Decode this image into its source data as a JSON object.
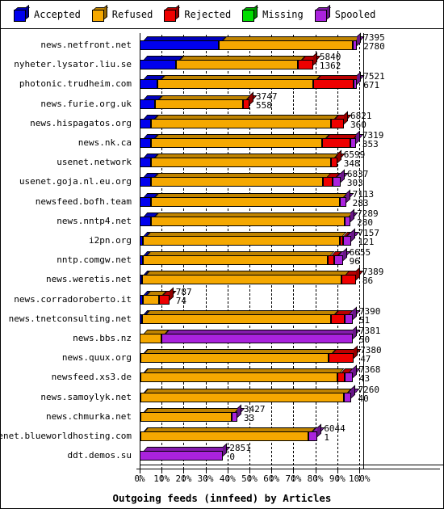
{
  "legend": {
    "items": [
      {
        "label": "Accepted",
        "color": "#0000ee",
        "icon": "cube-icon"
      },
      {
        "label": "Refused",
        "color": "#f5a800",
        "icon": "cube-icon"
      },
      {
        "label": "Rejected",
        "color": "#ee0000",
        "icon": "cube-icon"
      },
      {
        "label": "Missing",
        "color": "#00dd00",
        "icon": "cube-icon"
      },
      {
        "label": "Spooled",
        "color": "#aa22dd",
        "icon": "cube-icon"
      }
    ]
  },
  "axis": {
    "title": "Outgoing feeds (innfeed) by Articles",
    "ticks": [
      "0%",
      "10%",
      "20%",
      "30%",
      "40%",
      "50%",
      "60%",
      "70%",
      "80%",
      "90%",
      "100%"
    ]
  },
  "chart_data": {
    "type": "bar",
    "orientation": "horizontal",
    "stacked": true,
    "title": "Outgoing feeds (innfeed) by Articles",
    "xlabel": "Outgoing feeds (innfeed) by Articles",
    "ylabel": "",
    "xlim": [
      0,
      100
    ],
    "xticks": [
      0,
      10,
      20,
      30,
      40,
      50,
      60,
      70,
      80,
      90,
      100
    ],
    "xtick_labels": [
      "0%",
      "10%",
      "20%",
      "30%",
      "40%",
      "50%",
      "60%",
      "70%",
      "80%",
      "90%",
      "100%"
    ],
    "grid": true,
    "legend_position": "top",
    "series_names": [
      "Accepted",
      "Refused",
      "Rejected",
      "Missing",
      "Spooled"
    ],
    "series_colors": [
      "#0000ee",
      "#f5a800",
      "#ee0000",
      "#00dd00",
      "#aa22dd"
    ],
    "categories": [
      "news.netfront.net",
      "nyheter.lysator.liu.se",
      "photonic.trudheim.com",
      "news.furie.org.uk",
      "news.hispagatos.org",
      "news.nk.ca",
      "usenet.network",
      "usenet.goja.nl.eu.org",
      "newsfeed.bofh.team",
      "news.nntp4.net",
      "i2pn.org",
      "nntp.comgw.net",
      "news.weretis.net",
      "news.corradoroberto.it",
      "news.tnetconsulting.net",
      "news.bbs.nz",
      "news.quux.org",
      "newsfeed.xs3.de",
      "news.samoylyk.net",
      "news.chmurka.net",
      "usenet.blueworldhosting.com",
      "ddt.demos.su"
    ],
    "rows": [
      {
        "name": "news.netfront.net",
        "total": 7395,
        "spooled_count": 2780,
        "label_top": "7395",
        "label_bottom": "2780",
        "segments": [
          {
            "s": "Accepted",
            "pct": 36.0
          },
          {
            "s": "Refused",
            "pct": 61.0
          },
          {
            "s": "Spooled",
            "pct": 2.0
          }
        ]
      },
      {
        "name": "nyheter.lysator.liu.se",
        "total": 5840,
        "spooled_count": 1362,
        "label_top": "5840",
        "label_bottom": "1362",
        "segments": [
          {
            "s": "Accepted",
            "pct": 16.5
          },
          {
            "s": "Refused",
            "pct": 55.5
          },
          {
            "s": "Rejected",
            "pct": 7.0
          }
        ]
      },
      {
        "name": "photonic.trudheim.com",
        "total": 7521,
        "spooled_count": 671,
        "label_top": "7521",
        "label_bottom": "671",
        "segments": [
          {
            "s": "Accepted",
            "pct": 8.0
          },
          {
            "s": "Refused",
            "pct": 71.0
          },
          {
            "s": "Rejected",
            "pct": 18.5
          },
          {
            "s": "Spooled",
            "pct": 1.5
          }
        ]
      },
      {
        "name": "news.furie.org.uk",
        "total": 3747,
        "spooled_count": 558,
        "label_top": "3747",
        "label_bottom": "558",
        "segments": [
          {
            "s": "Accepted",
            "pct": 7.0
          },
          {
            "s": "Refused",
            "pct": 40.0
          },
          {
            "s": "Rejected",
            "pct": 3.0
          }
        ]
      },
      {
        "name": "news.hispagatos.org",
        "total": 6821,
        "spooled_count": 360,
        "label_top": "6821",
        "label_bottom": "360",
        "segments": [
          {
            "s": "Accepted",
            "pct": 5.0
          },
          {
            "s": "Refused",
            "pct": 82.0
          },
          {
            "s": "Rejected",
            "pct": 6.0
          }
        ]
      },
      {
        "name": "news.nk.ca",
        "total": 7319,
        "spooled_count": 353,
        "label_top": "7319",
        "label_bottom": "353",
        "segments": [
          {
            "s": "Accepted",
            "pct": 5.0
          },
          {
            "s": "Refused",
            "pct": 78.0
          },
          {
            "s": "Rejected",
            "pct": 13.0
          },
          {
            "s": "Spooled",
            "pct": 2.5
          }
        ]
      },
      {
        "name": "usenet.network",
        "total": 6599,
        "spooled_count": 348,
        "label_top": "6599",
        "label_bottom": "348",
        "segments": [
          {
            "s": "Accepted",
            "pct": 5.0
          },
          {
            "s": "Refused",
            "pct": 82.0
          },
          {
            "s": "Rejected",
            "pct": 3.0
          }
        ]
      },
      {
        "name": "usenet.goja.nl.eu.org",
        "total": 6837,
        "spooled_count": 303,
        "label_top": "6837",
        "label_bottom": "303",
        "segments": [
          {
            "s": "Accepted",
            "pct": 5.0
          },
          {
            "s": "Refused",
            "pct": 78.5
          },
          {
            "s": "Rejected",
            "pct": 4.5
          },
          {
            "s": "Spooled",
            "pct": 3.5
          }
        ]
      },
      {
        "name": "newsfeed.bofh.team",
        "total": 7113,
        "spooled_count": 283,
        "label_top": "7113",
        "label_bottom": "283",
        "segments": [
          {
            "s": "Accepted",
            "pct": 5.0
          },
          {
            "s": "Refused",
            "pct": 86.0
          },
          {
            "s": "Spooled",
            "pct": 3.0
          }
        ]
      },
      {
        "name": "news.nntp4.net",
        "total": 7289,
        "spooled_count": 280,
        "label_top": "7289",
        "label_bottom": "280",
        "segments": [
          {
            "s": "Accepted",
            "pct": 5.0
          },
          {
            "s": "Refused",
            "pct": 88.5
          },
          {
            "s": "Spooled",
            "pct": 2.5
          }
        ]
      },
      {
        "name": "i2pn.org",
        "total": 7157,
        "spooled_count": 121,
        "label_top": "7157",
        "label_bottom": "121",
        "segments": [
          {
            "s": "Accepted",
            "pct": 1.5
          },
          {
            "s": "Refused",
            "pct": 89.5
          },
          {
            "s": "Rejected",
            "pct": 1.5
          },
          {
            "s": "Spooled",
            "pct": 4.0
          }
        ]
      },
      {
        "name": "nntp.comgw.net",
        "total": 6655,
        "spooled_count": 96,
        "label_top": "6655",
        "label_bottom": "96",
        "segments": [
          {
            "s": "Accepted",
            "pct": 1.5
          },
          {
            "s": "Refused",
            "pct": 84.0
          },
          {
            "s": "Rejected",
            "pct": 3.0
          },
          {
            "s": "Spooled",
            "pct": 4.0
          }
        ]
      },
      {
        "name": "news.weretis.net",
        "total": 7389,
        "spooled_count": 86,
        "label_top": "7389",
        "label_bottom": "86",
        "segments": [
          {
            "s": "Accepted",
            "pct": 1.0
          },
          {
            "s": "Refused",
            "pct": 91.0
          },
          {
            "s": "Rejected",
            "pct": 6.5
          }
        ]
      },
      {
        "name": "news.corradoroberto.it",
        "total": 787,
        "spooled_count": 74,
        "label_top": "787",
        "label_bottom": "74",
        "segments": [
          {
            "s": "Accepted",
            "pct": 1.5
          },
          {
            "s": "Refused",
            "pct": 7.5
          },
          {
            "s": "Rejected",
            "pct": 4.5
          }
        ]
      },
      {
        "name": "news.tnetconsulting.net",
        "total": 7390,
        "spooled_count": 51,
        "label_top": "7390",
        "label_bottom": "51",
        "segments": [
          {
            "s": "Accepted",
            "pct": 1.0
          },
          {
            "s": "Refused",
            "pct": 86.0
          },
          {
            "s": "Rejected",
            "pct": 6.5
          },
          {
            "s": "Spooled",
            "pct": 3.5
          }
        ]
      },
      {
        "name": "news.bbs.nz",
        "total": 7381,
        "spooled_count": 50,
        "label_top": "7381",
        "label_bottom": "50",
        "segments": [
          {
            "s": "Refused",
            "pct": 10.0
          },
          {
            "s": "Spooled",
            "pct": 87.0
          }
        ]
      },
      {
        "name": "news.quux.org",
        "total": 7380,
        "spooled_count": 47,
        "label_top": "7380",
        "label_bottom": "47",
        "segments": [
          {
            "s": "Accepted",
            "pct": 0.5
          },
          {
            "s": "Refused",
            "pct": 85.5
          },
          {
            "s": "Rejected",
            "pct": 11.5
          }
        ]
      },
      {
        "name": "newsfeed.xs3.de",
        "total": 7368,
        "spooled_count": 43,
        "label_top": "7368",
        "label_bottom": "43",
        "segments": [
          {
            "s": "Accepted",
            "pct": 0.5
          },
          {
            "s": "Refused",
            "pct": 89.5
          },
          {
            "s": "Rejected",
            "pct": 3.5
          },
          {
            "s": "Spooled",
            "pct": 3.5
          }
        ]
      },
      {
        "name": "news.samoylyk.net",
        "total": 7260,
        "spooled_count": 40,
        "label_top": "7260",
        "label_bottom": "40",
        "segments": [
          {
            "s": "Accepted",
            "pct": 0.5
          },
          {
            "s": "Refused",
            "pct": 92.5
          },
          {
            "s": "Spooled",
            "pct": 3.5
          }
        ]
      },
      {
        "name": "news.chmurka.net",
        "total": 3427,
        "spooled_count": 33,
        "label_top": "3427",
        "label_bottom": "33",
        "segments": [
          {
            "s": "Accepted",
            "pct": 0.5
          },
          {
            "s": "Refused",
            "pct": 41.5
          },
          {
            "s": "Spooled",
            "pct": 2.5
          }
        ]
      },
      {
        "name": "usenet.blueworldhosting.com",
        "total": 6044,
        "spooled_count": 1,
        "label_top": "6044",
        "label_bottom": "1",
        "segments": [
          {
            "s": "Accepted",
            "pct": 0.5
          },
          {
            "s": "Refused",
            "pct": 76.5
          },
          {
            "s": "Spooled",
            "pct": 4.0
          }
        ]
      },
      {
        "name": "ddt.demos.su",
        "total": 2851,
        "spooled_count": 0,
        "label_top": "2851",
        "label_bottom": "0",
        "segments": [
          {
            "s": "Spooled",
            "pct": 38.0
          }
        ]
      }
    ]
  }
}
